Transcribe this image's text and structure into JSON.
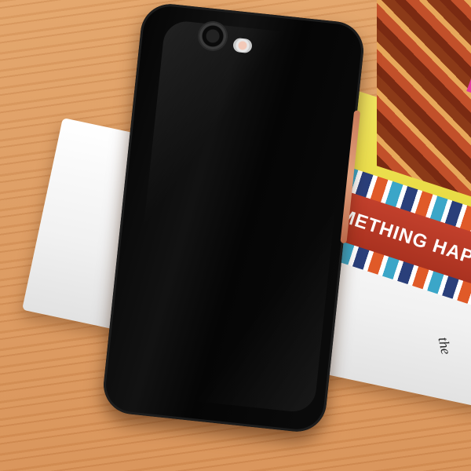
{
  "scene": {
    "colors": {
      "table": "#dd9c62",
      "phone": "#080808",
      "book_red_band": "#b8392a",
      "book_yellow": "#ece048"
    },
    "book_spine_text": "SOMETHING HAP",
    "white_book_text": "the"
  }
}
